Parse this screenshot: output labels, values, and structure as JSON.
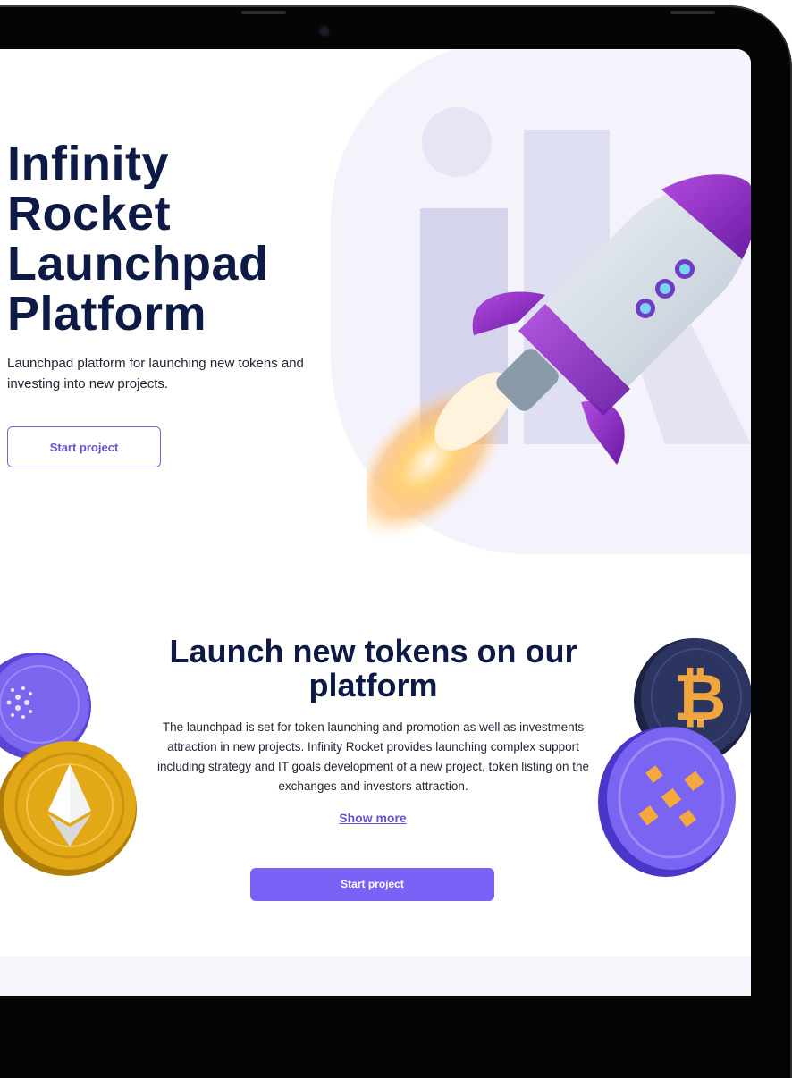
{
  "hero": {
    "title_lines": [
      "Infinity",
      "Rocket",
      "Launchpad",
      "Platform"
    ],
    "subtitle": "Launchpad platform for launching new tokens and investing into new projects.",
    "cta_label": "Start project"
  },
  "launch_section": {
    "title": "Launch new tokens on our platform",
    "body": "The launchpad is set for token launching and promotion as well as investments attraction in new projects. Infinity Rocket provides launching complex support including strategy and IT goals development of a new project, token listing on the exchanges and investors attraction.",
    "show_more_label": "Show more",
    "cta_label": "Start project"
  },
  "colors": {
    "heading": "#0c1a45",
    "accent": "#7b61f5",
    "accent_text": "#6a52d1",
    "hero_bg": "#f4f3fc"
  },
  "icons": [
    "rocket-illustration",
    "cardano-coin-icon",
    "ethereum-coin-icon",
    "bitcoin-coin-icon",
    "bnb-coin-icon"
  ]
}
